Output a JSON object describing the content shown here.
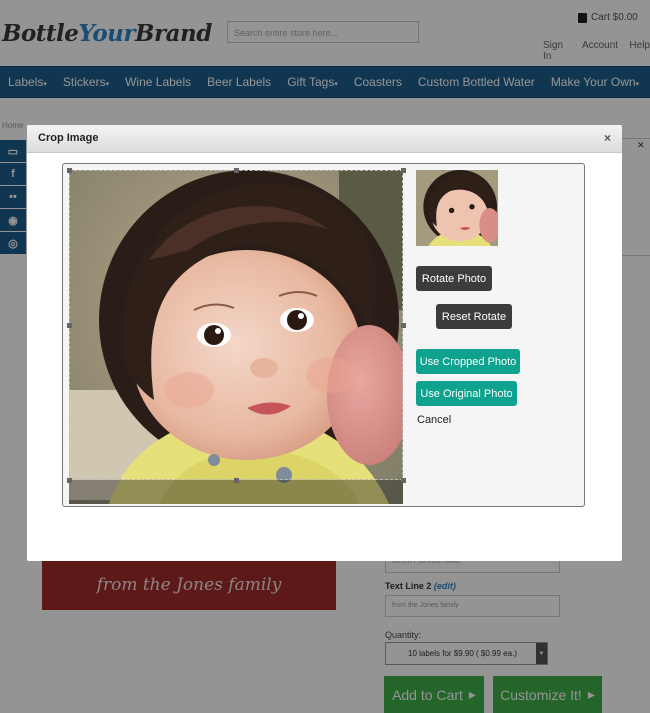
{
  "header": {
    "logo_part1": "Bottle",
    "logo_part2": "Your",
    "logo_part3": "Brand",
    "search_placeholder": "Search entire store here...",
    "cart_label": "Cart $0.00",
    "links": [
      "Sign In",
      "Account",
      "Help"
    ]
  },
  "nav": {
    "items": [
      {
        "label": "Labels",
        "caret": true
      },
      {
        "label": "Stickers",
        "caret": true
      },
      {
        "label": "Wine Labels",
        "caret": false
      },
      {
        "label": "Beer Labels",
        "caret": false
      },
      {
        "label": "Gift Tags",
        "caret": true
      },
      {
        "label": "Coasters",
        "caret": false
      },
      {
        "label": "Custom Bottled Water",
        "caret": false
      },
      {
        "label": "Make Your Own",
        "caret": true
      }
    ]
  },
  "breadcrumb": "Home",
  "page": {
    "label_text": "from the Jones family",
    "text_line1_value": "MERRY CHRISTMAS",
    "text_line2_label": "Text Line 2",
    "text_line2_edit": "(edit)",
    "text_line2_value": "from the Jones family",
    "quantity_label": "Quantity:",
    "quantity_value": "10 labels for $9.90 ( $0.99 ea.)",
    "add_to_cart": "Add to Cart",
    "customize": "Customize It!"
  },
  "modal": {
    "title": "Crop Image",
    "close": "×",
    "rotate_photo": "Rotate Photo",
    "reset_rotate": "Reset Rotate",
    "use_cropped": "Use Cropped Photo",
    "use_original": "Use Original Photo",
    "cancel": "Cancel"
  },
  "colors": {
    "nav": "#1e5d8c",
    "accent": "#2f86c9",
    "teal_button": "#0fa38f",
    "dark_button": "#3c3c3c",
    "green_button": "#3eae49",
    "label_red": "#a12a2a"
  }
}
